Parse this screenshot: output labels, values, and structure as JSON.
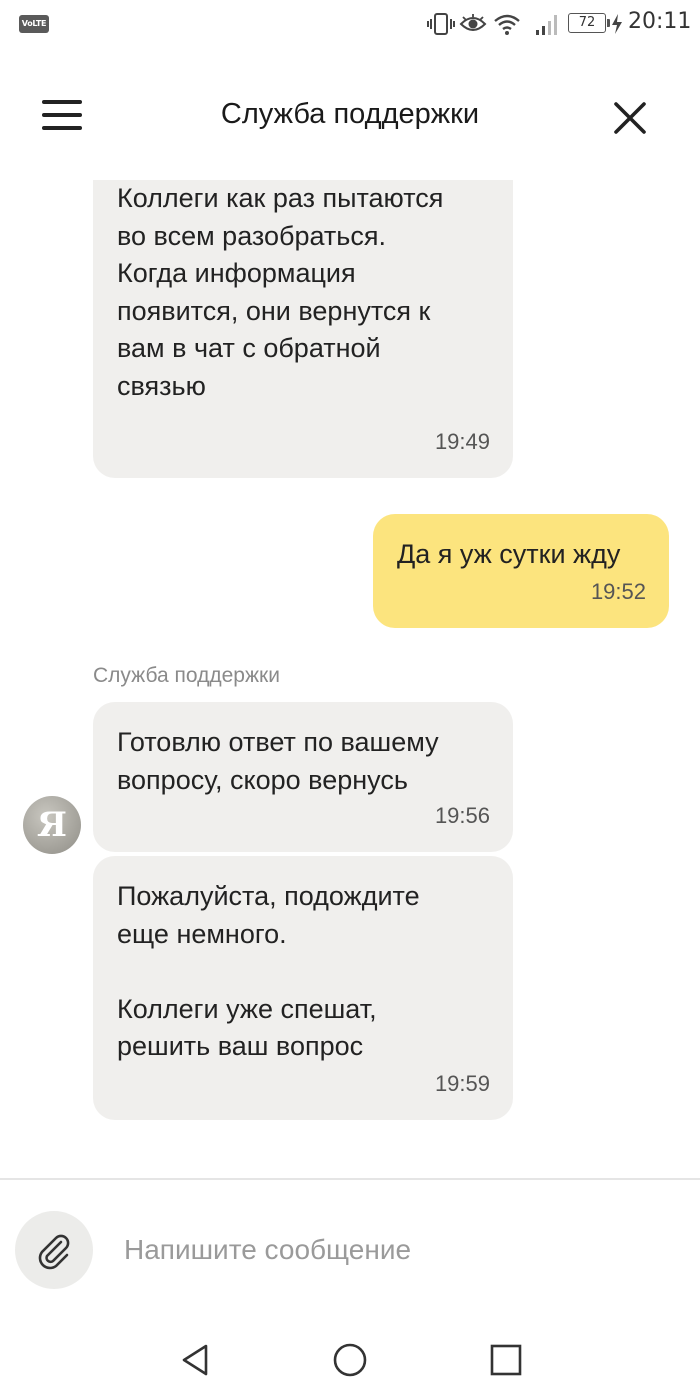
{
  "status_bar": {
    "network_badge": "VoLTE",
    "battery_level": "72",
    "time": "20:11",
    "icons": [
      "vibrate-icon",
      "eye-icon",
      "wifi-icon",
      "signal-icon",
      "battery-icon",
      "charging-icon"
    ]
  },
  "header": {
    "title": "Служба поддержки",
    "menu_icon": "hamburger-menu-icon",
    "close_icon": "close-icon"
  },
  "messages": [
    {
      "direction": "incoming",
      "text": "Коллеги как раз пытаются\nво всем разобраться.\nКогда информация\nпоявится, они вернутся к\nвам в чат с обратной\nсвязью",
      "time": "19:49"
    },
    {
      "direction": "outgoing",
      "text": "Да я уж сутки жду",
      "time": "19:52"
    },
    {
      "direction": "incoming",
      "sender": "Служба поддержки",
      "text": "Готовлю ответ по вашему\nвопросу, скоро вернусь",
      "time": "19:56"
    },
    {
      "direction": "incoming",
      "text": "Пожалуйста, подождите\nеще немного.\n\nКоллеги уже спешат,\nрешить ваш вопрос",
      "time": "19:59"
    }
  ],
  "avatar": {
    "letter": "Я"
  },
  "composer": {
    "placeholder": "Напишите сообщение",
    "value": "",
    "attach_icon": "paperclip-icon"
  },
  "nav_bar": {
    "buttons": [
      "back-icon",
      "home-icon",
      "recents-icon"
    ]
  },
  "colors": {
    "incoming_bubble": "#f0efed",
    "outgoing_bubble": "#fce47e",
    "background": "#ffffff"
  }
}
